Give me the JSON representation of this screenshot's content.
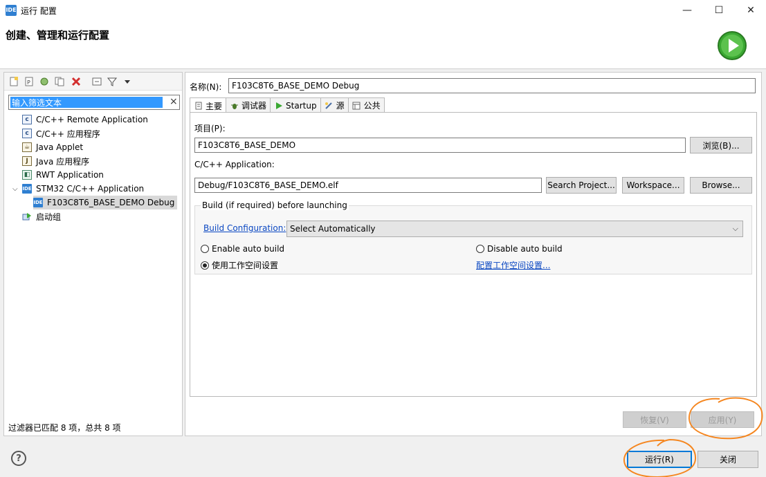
{
  "window": {
    "title": "运行 配置",
    "app_icon": "IDE",
    "controls": {
      "minimize": "—",
      "maximize": "☐",
      "close": "✕"
    }
  },
  "header": {
    "title": "创建、管理和运行配置",
    "run_icon": "run-icon"
  },
  "left_panel": {
    "toolbar_icons": [
      "new-configuration-icon",
      "new-prototype-icon",
      "export-icon",
      "duplicate-icon",
      "delete-icon",
      "collapse-all-icon",
      "filter-icon",
      "view-menu-icon"
    ],
    "filter_placeholder": "输入筛选文本",
    "filter_value": "输入筛选文本",
    "tree": [
      {
        "label": "C/C++ Remote Application",
        "icon": "c-app-icon"
      },
      {
        "label": "C/C++ 应用程序",
        "icon": "c-app-icon"
      },
      {
        "label": "Java Applet",
        "icon": "java-applet-icon"
      },
      {
        "label": "Java 应用程序",
        "icon": "java-app-icon"
      },
      {
        "label": "RWT Application",
        "icon": "rwt-app-icon"
      },
      {
        "label": "STM32 C/C++ Application",
        "icon": "ide-icon",
        "expanded": true
      },
      {
        "label": "F103C8T6_BASE_DEMO Debug",
        "icon": "ide-icon",
        "selected": true
      },
      {
        "label": "启动组",
        "icon": "launch-group-icon"
      }
    ],
    "status": "过滤器已匹配 8 项，总共 8 项"
  },
  "right_panel": {
    "name_label": "名称(N):",
    "name_value": "F103C8T6_BASE_DEMO Debug",
    "tabs": [
      {
        "label": "主要",
        "icon": "main-tab-icon",
        "active": true
      },
      {
        "label": "调试器",
        "icon": "debugger-icon"
      },
      {
        "label": "Startup",
        "icon": "startup-icon"
      },
      {
        "label": "源",
        "icon": "source-icon"
      },
      {
        "label": "公共",
        "icon": "common-icon"
      }
    ],
    "project_label": "项目(P):",
    "project_value": "F103C8T6_BASE_DEMO",
    "browse_project_label": "浏览(B)...",
    "application_label": "C/C++ Application:",
    "application_value": "Debug/F103C8T6_BASE_DEMO.elf",
    "search_project_label": "Search Project...",
    "workspace_label": "Workspace...",
    "browse_app_label": "Browse...",
    "build_group": {
      "title": "Build (if required) before launching",
      "config_link": "Build Configuration:",
      "config_value": "Select Automatically",
      "enable_auto_build": "Enable auto build",
      "disable_auto_build": "Disable auto build",
      "use_workspace": "使用工作空间设置",
      "workspace_settings_link": "配置工作空间设置...",
      "selected": "use_workspace"
    },
    "revert_label": "恢复(V)",
    "apply_label": "应用(Y)"
  },
  "footer": {
    "help_icon": "help-icon",
    "help_glyph": "?",
    "run_label": "运行(R)",
    "close_label": "关闭"
  },
  "colors": {
    "selection": "#3399ff",
    "link": "#0a47c2",
    "annotation": "#f5861f",
    "run_green": "#3aa832"
  }
}
